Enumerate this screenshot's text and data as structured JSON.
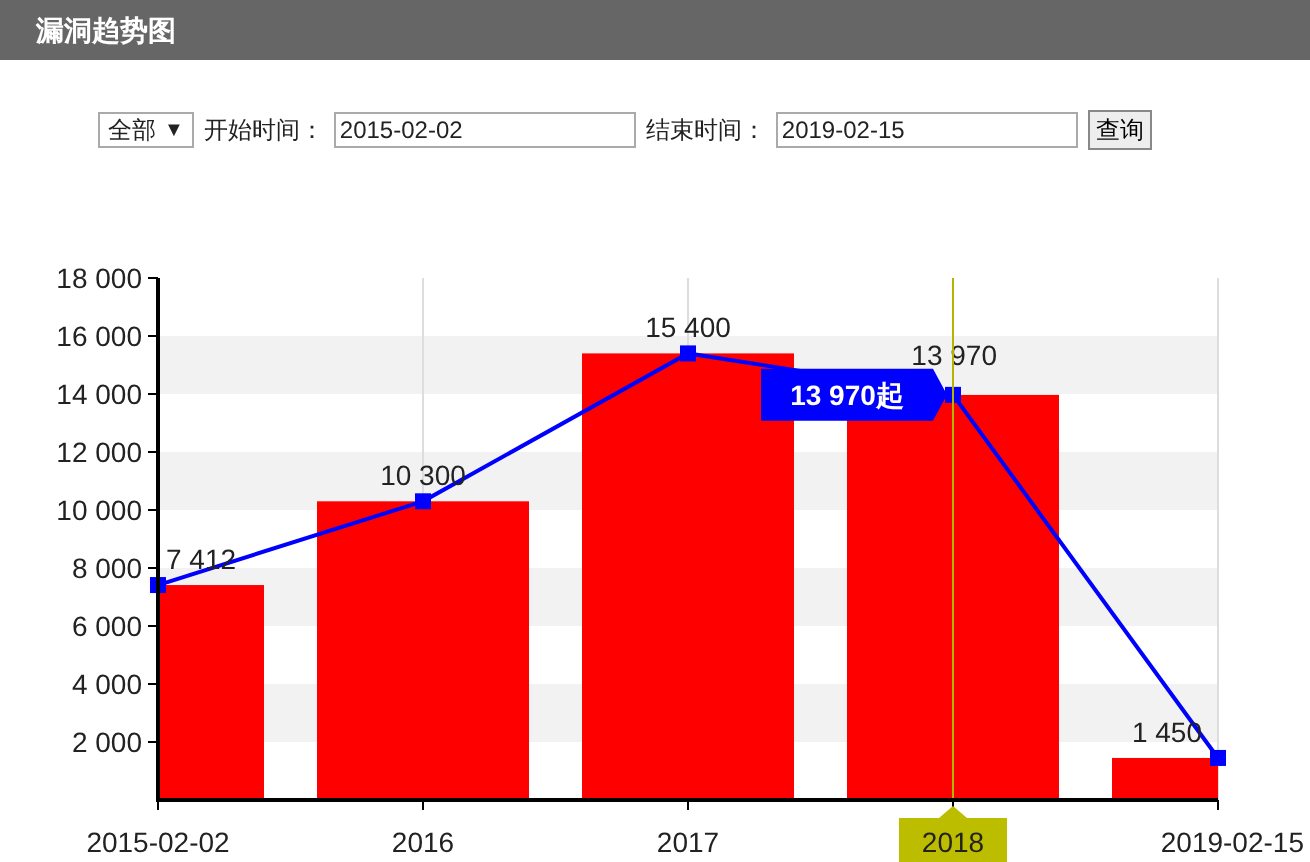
{
  "header": {
    "title": "漏洞趋势图"
  },
  "filters": {
    "scope": {
      "value": "全部",
      "arrow": "▼"
    },
    "start_label": "开始时间：",
    "start_value": "2015-02-02",
    "end_label": "结束时间：",
    "end_value": "2019-02-15",
    "query_button": "查询"
  },
  "chart": {
    "chart_data": {
      "type": "bar",
      "ylim": [
        0,
        18000
      ],
      "categories": [
        "2015-02-02",
        "2016",
        "2017",
        "2018",
        "2019-02-15"
      ],
      "yticks": [
        {
          "value": 2000,
          "label": "2 000"
        },
        {
          "value": 4000,
          "label": "4 000"
        },
        {
          "value": 6000,
          "label": "6 000"
        },
        {
          "value": 8000,
          "label": "8 000"
        },
        {
          "value": 10000,
          "label": "10 000"
        },
        {
          "value": 12000,
          "label": "12 000"
        },
        {
          "value": 14000,
          "label": "14 000"
        },
        {
          "value": 16000,
          "label": "16 000"
        },
        {
          "value": 18000,
          "label": "18 000"
        }
      ],
      "ref_lines": [
        {
          "axis": "x",
          "value": "2018",
          "color": "#b5b500"
        }
      ],
      "series": [
        {
          "color": "#ff0000",
          "values": [
            7412,
            10300,
            15400,
            13970,
            1450
          ],
          "value_labels": [
            "7 412",
            "10 300",
            "15 400",
            "13 970",
            "1 450"
          ]
        },
        {
          "type": "line",
          "color": "#0000ff",
          "marker": "square",
          "values": [
            7412,
            10300,
            15400,
            13970,
            1450
          ]
        }
      ]
    },
    "category_states": [
      {
        "selected": false
      },
      {
        "selected": false
      },
      {
        "selected": false
      },
      {
        "selected": true
      },
      {
        "selected": false
      }
    ],
    "tooltip": {
      "text": "13 970起"
    }
  }
}
